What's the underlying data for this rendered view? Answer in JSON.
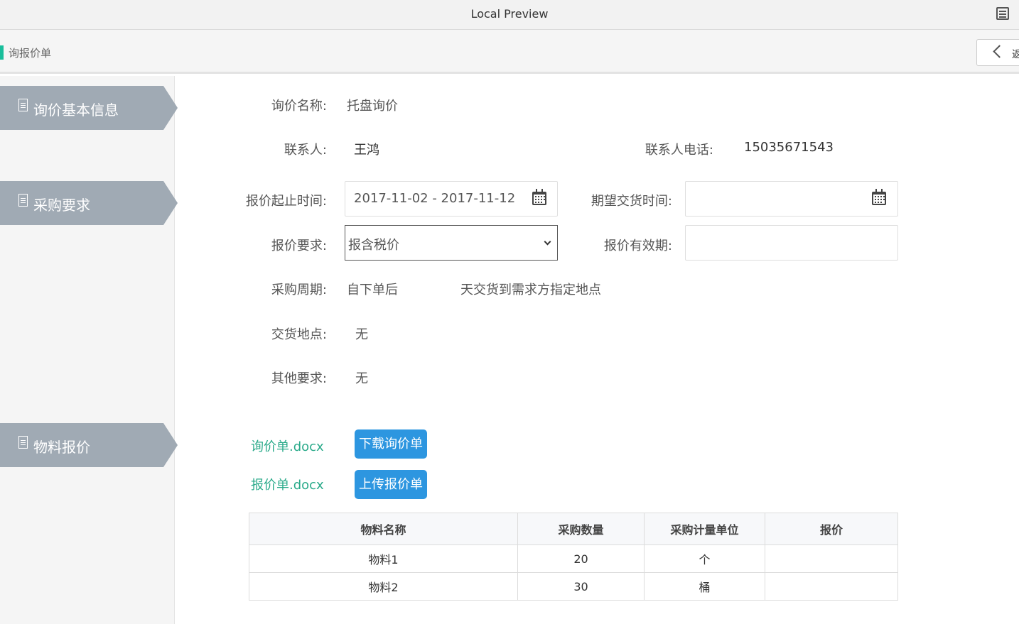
{
  "window": {
    "title": "Local Preview",
    "menu_icon": "list-menu-icon"
  },
  "breadcrumb": {
    "label": "询报价单",
    "accent_color": "#19be9b"
  },
  "back_button": {
    "label": "返"
  },
  "sidebar": {
    "tabs": [
      {
        "label": "询价基本信息",
        "icon": "document-icon"
      },
      {
        "label": "采购要求",
        "icon": "document-icon"
      },
      {
        "label": "物料报价",
        "icon": "document-icon"
      }
    ]
  },
  "form": {
    "inquiry_name": {
      "label": "询价名称:",
      "value": "托盘询价"
    },
    "contact": {
      "label": "联系人:",
      "value": "王鸿"
    },
    "contact_phone": {
      "label": "联系人电话:",
      "value": "15035671543"
    },
    "quote_period": {
      "label": "报价起止时间:",
      "value": "2017-11-02 - 2017-11-12"
    },
    "expected_delivery": {
      "label": "期望交货时间:",
      "value": ""
    },
    "quote_requirement": {
      "label": "报价要求:",
      "selected": "报含税价"
    },
    "quote_validity": {
      "label": "报价有效期:",
      "value": ""
    },
    "purchase_cycle": {
      "label": "采购周期:",
      "value_prefix": "自下单后",
      "value_suffix": "天交货到需求方指定地点"
    },
    "delivery_location": {
      "label": "交货地点:",
      "value": "无"
    },
    "other_requirements": {
      "label": "其他要求:",
      "value": "无"
    }
  },
  "files": [
    {
      "name": "询价单.docx",
      "button": "下载询价单"
    },
    {
      "name": "报价单.docx",
      "button": "上传报价单"
    }
  ],
  "colors": {
    "tab_bg": "#a0aab4",
    "link": "#2aaa8a",
    "button": "#2d96e0"
  },
  "material_table": {
    "headers": [
      "物料名称",
      "采购数量",
      "采购计量单位",
      "报价"
    ],
    "rows": [
      [
        "物料1",
        "20",
        "个",
        ""
      ],
      [
        "物料2",
        "30",
        "桶",
        ""
      ]
    ]
  }
}
